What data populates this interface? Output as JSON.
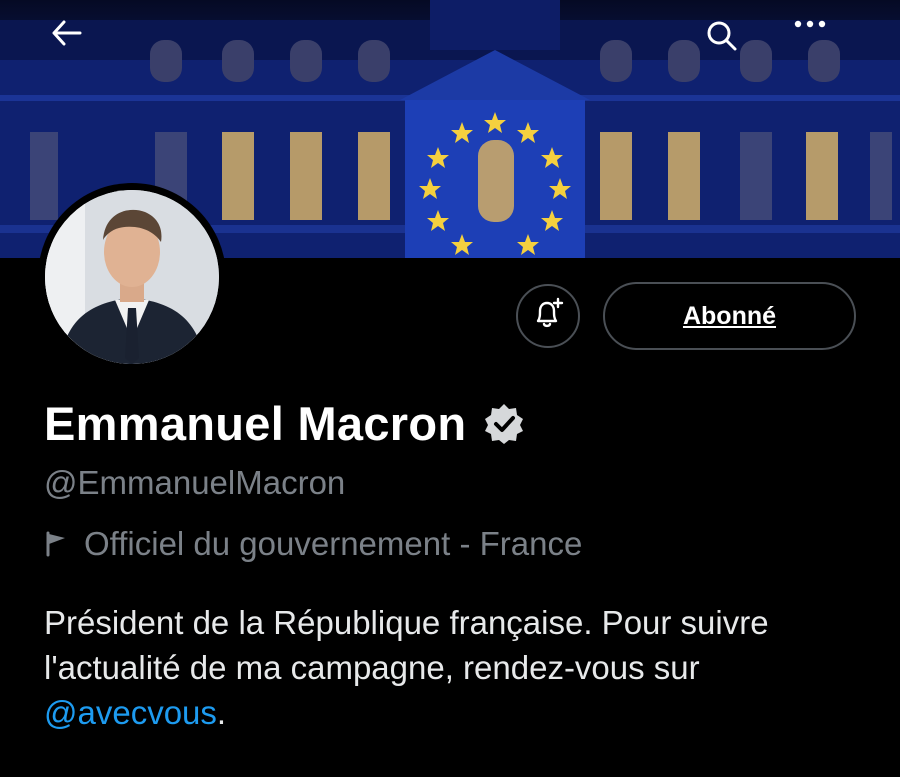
{
  "profile": {
    "name": "Emmanuel Macron",
    "handle": "@EmmanuelMacron",
    "affiliation_label": "Officiel du gouvernement - France",
    "bio_text": "Président de la République française. Pour suivre l'actualité de ma campagne, rendez-vous sur ",
    "bio_mention": "@avecvous",
    "bio_end": ".",
    "verified": true
  },
  "actions": {
    "follow_label": "Abonné",
    "notify_icon": "bell-plus-icon"
  },
  "topbar": {
    "back_icon": "arrow-left-icon",
    "search_icon": "search-icon",
    "more_icon": "more-horizontal-icon"
  },
  "colors": {
    "background": "#000000",
    "text_primary": "#e7e9ea",
    "text_secondary": "#7b8188",
    "link": "#1d9bf0",
    "button_border": "#4a4f55"
  }
}
